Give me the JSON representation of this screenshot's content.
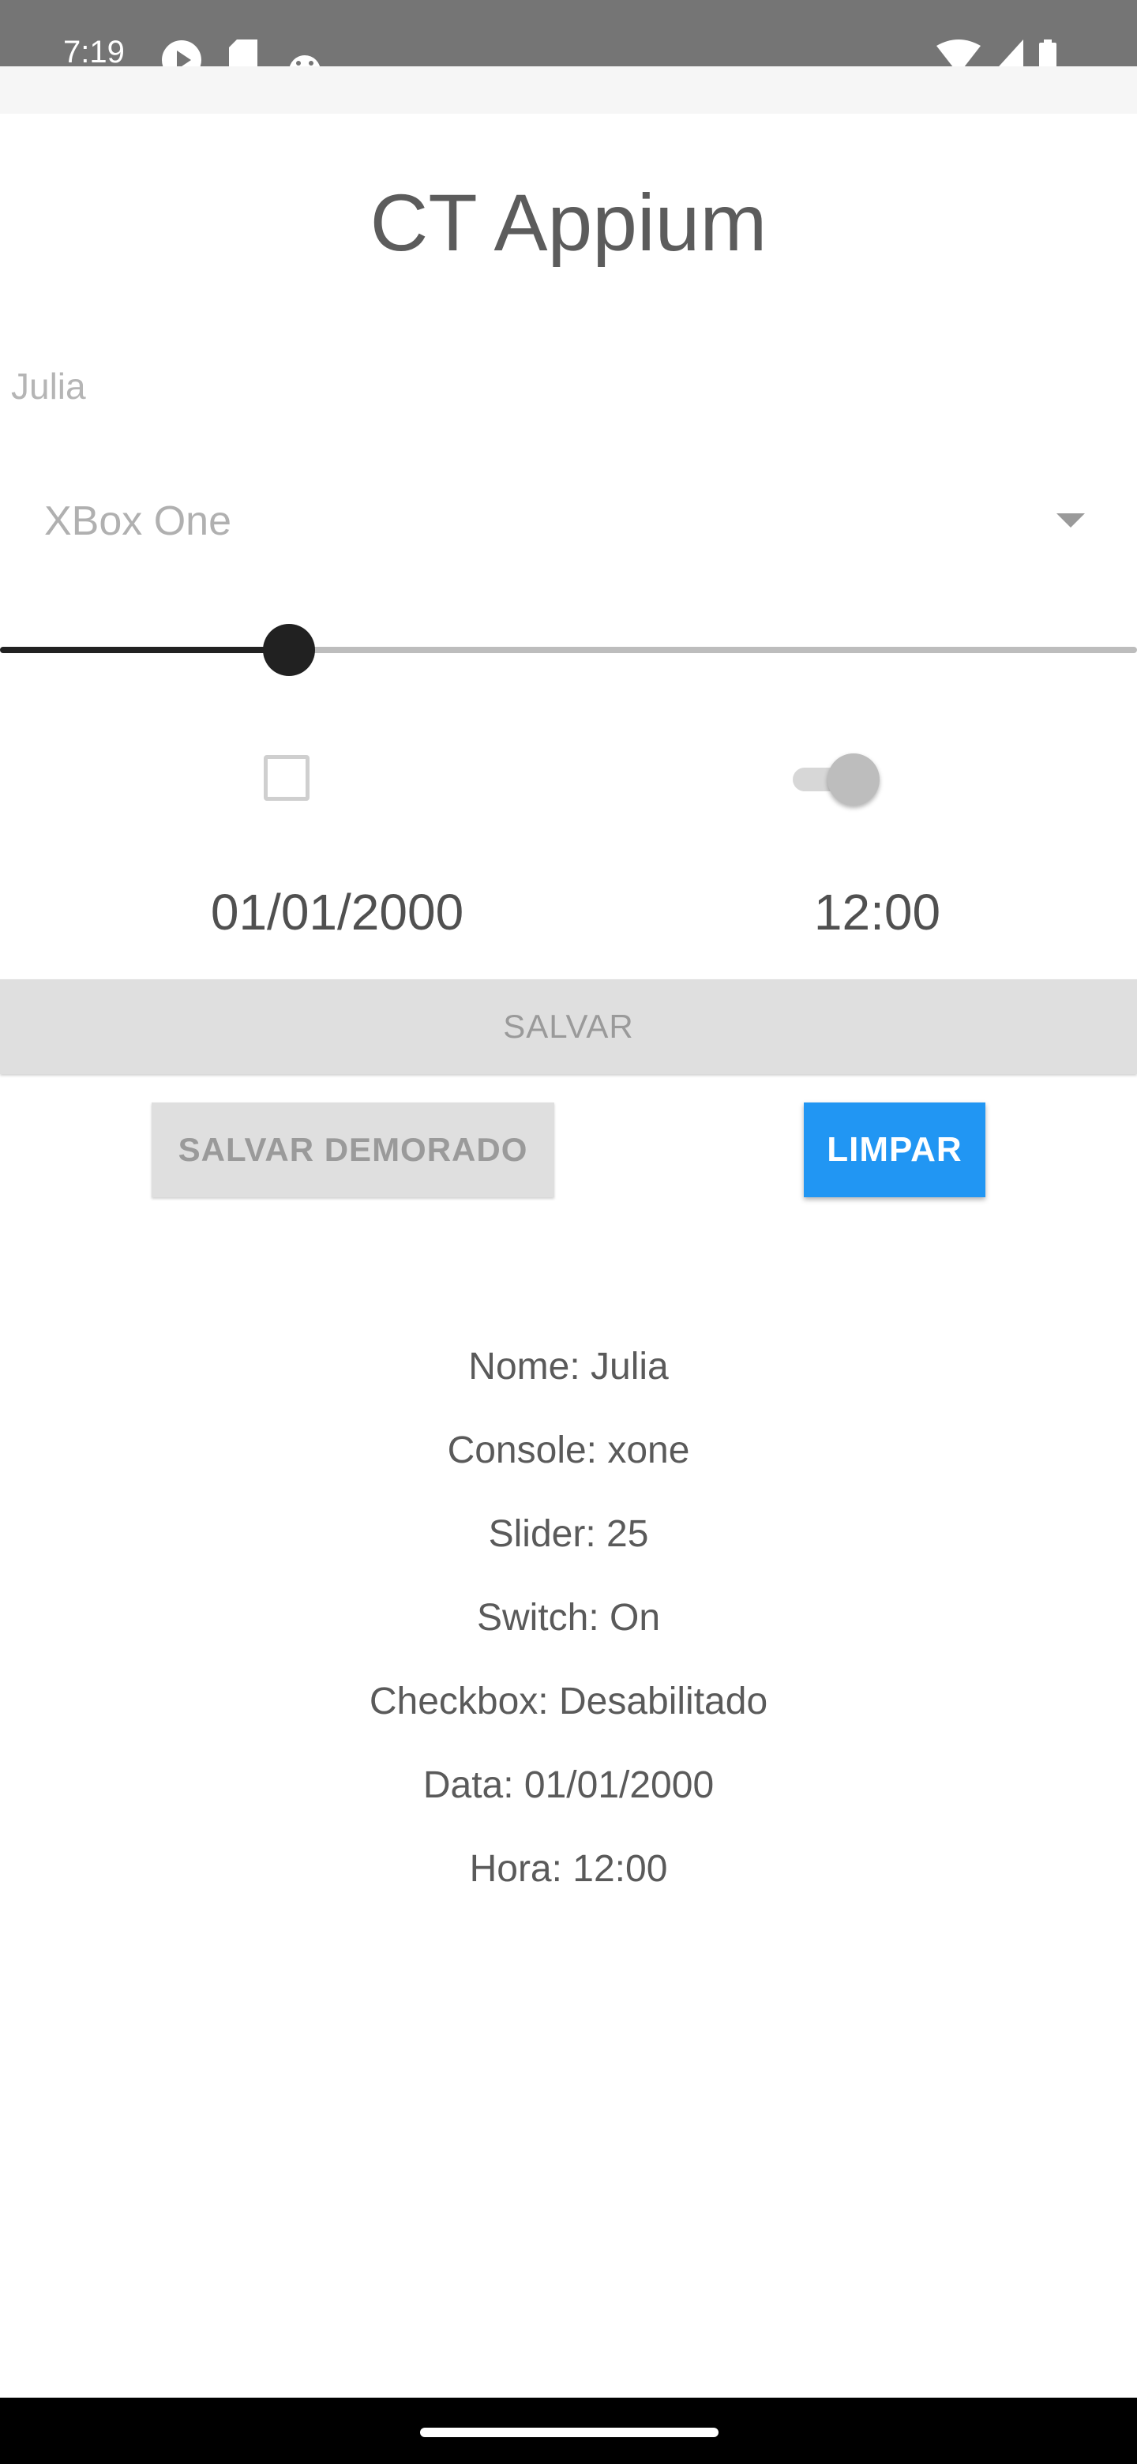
{
  "status_bar": {
    "time": "7:19",
    "icons": [
      "play-icon",
      "sd-card-icon",
      "android-icon",
      "wifi-icon",
      "signal-icon",
      "battery-icon"
    ]
  },
  "title": "CT Appium",
  "form": {
    "name_value": "Julia",
    "console_selected": "XBox One",
    "slider_value": 25,
    "slider_max": 100,
    "checkbox_checked": false,
    "switch_on": true,
    "date": "01/01/2000",
    "time": "12:00"
  },
  "buttons": {
    "salvar": "SALVAR",
    "salvar_demorado": "SALVAR DEMORADO",
    "limpar": "LIMPAR"
  },
  "summary": {
    "nome": "Nome: Julia",
    "console": "Console: xone",
    "slider": "Slider: 25",
    "switch": "Switch: On",
    "checkbox": "Checkbox: Desabilitado",
    "data": "Data: 01/01/2000",
    "hora": "Hora: 12:00"
  },
  "colors": {
    "accent": "#2196f3",
    "status_bar": "#757575",
    "slider_active": "#212121"
  }
}
